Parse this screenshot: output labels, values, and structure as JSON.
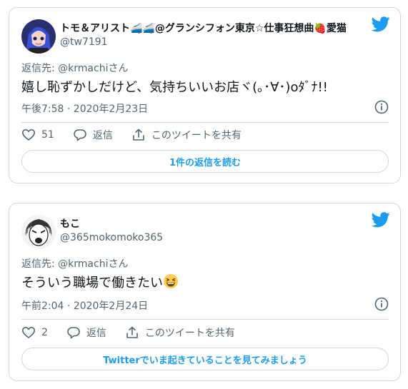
{
  "colors": {
    "twitter_blue": "#1d9bf0",
    "muted": "#536471",
    "border": "#cfd9de",
    "like_red": "#e0245e"
  },
  "tweets": [
    {
      "display_name": "トモ＆アリスト🚄🚄@グランシフォン東京☆仕事狂想曲🍓愛猫",
      "handle": "@tw7191",
      "reply_prefix": "返信先: ",
      "reply_mention": "@krmachiさん",
      "text": "嬉し恥ずかしだけど、気持ちいいお店ヾ(｡･∀･)oﾀﾞﾅ!!",
      "timestamp": "午後7:58 · 2020年2月23日",
      "like_count": "51",
      "reply_label": "返信",
      "share_label": "このツイートを共有",
      "cta_label": "1件の返信を読む",
      "avatar_icon": "anime-avatar-icon"
    },
    {
      "display_name": "もこ",
      "handle": "@365mokomoko365",
      "reply_prefix": "返信先: ",
      "reply_mention": "@krmachiさん",
      "text": "そういう職場で働きたい",
      "emoji": "😆",
      "timestamp": "午前2:04 · 2020年2月24日",
      "like_count": "2",
      "reply_label": "返信",
      "share_label": "このツイートを共有",
      "cta_label": "Twitterでいま起きていることを見てみましょう",
      "avatar_icon": "sketch-avatar-icon"
    }
  ]
}
